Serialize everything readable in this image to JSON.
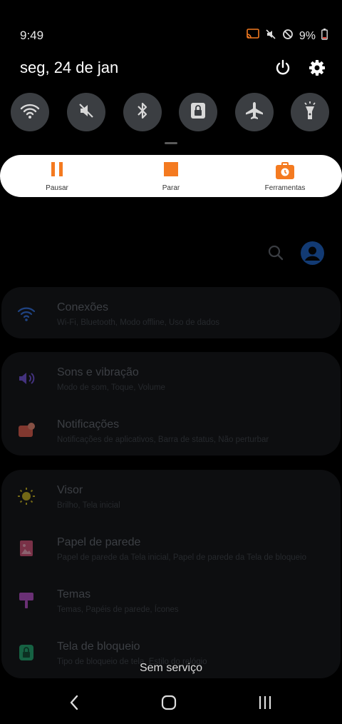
{
  "status_bar": {
    "time": "9:49",
    "battery": "9%"
  },
  "panel": {
    "date": "seg, 24 de jan"
  },
  "quick_toggles": [
    {
      "name": "wifi"
    },
    {
      "name": "sound-muted"
    },
    {
      "name": "bluetooth"
    },
    {
      "name": "rotation-lock"
    },
    {
      "name": "airplane-mode"
    },
    {
      "name": "flashlight"
    }
  ],
  "recorder": {
    "pause_label": "Pausar",
    "stop_label": "Parar",
    "tools_label": "Ferramentas",
    "accent": "#f47a20"
  },
  "settings": {
    "items": [
      {
        "title": "Conexões",
        "subtitle": "Wi-Fi, Bluetooth, Modo offline, Uso de dados",
        "icon": "wifi-icon"
      },
      {
        "title": "Sons e vibração",
        "subtitle": "Modo de som, Toque, Volume",
        "icon": "speaker-icon"
      },
      {
        "title": "Notificações",
        "subtitle": "Notificações de aplicativos, Barra de status, Não perturbar",
        "icon": "bell-icon"
      },
      {
        "title": "Visor",
        "subtitle": "Brilho, Tela inicial",
        "icon": "sun-icon"
      },
      {
        "title": "Papel de parede",
        "subtitle": "Papel de parede da Tela inicial, Papel de parede da Tela de bloqueio",
        "icon": "picture-icon"
      },
      {
        "title": "Temas",
        "subtitle": "Temas, Papéis de parede, Ícones",
        "icon": "brush-icon"
      },
      {
        "title": "Tela de bloqueio",
        "subtitle": "Tipo de bloqueio de tela, Estilo do relógio",
        "icon": "lock-icon"
      }
    ]
  },
  "network_status": "Sem serviço"
}
